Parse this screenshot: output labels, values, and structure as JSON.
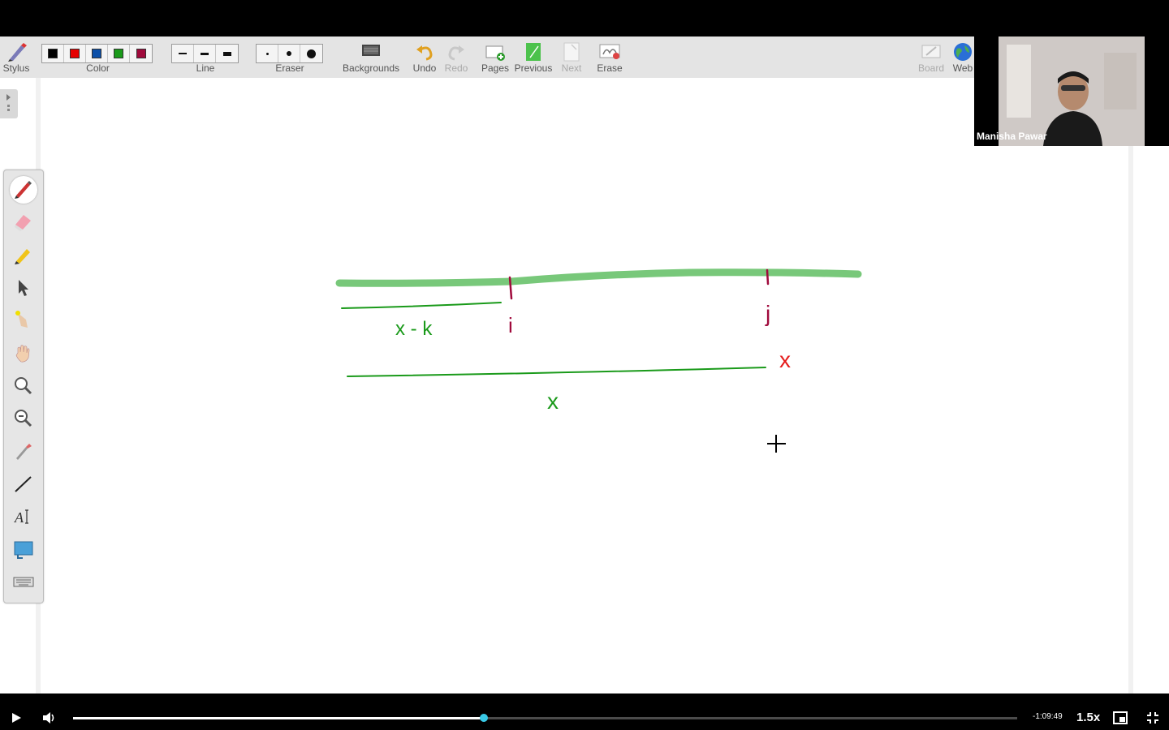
{
  "toolbar": {
    "stylus_label": "Stylus",
    "color_label": "Color",
    "colors": [
      "#000000",
      "#e50000",
      "#0b4fa8",
      "#1a9a1a",
      "#a00a3c"
    ],
    "line_label": "Line",
    "eraser_label": "Eraser",
    "backgrounds_label": "Backgrounds",
    "undo_label": "Undo",
    "redo_label": "Redo",
    "pages_label": "Pages",
    "previous_label": "Previous",
    "next_label": "Next",
    "erase_label": "Erase",
    "board_label": "Board",
    "web_label": "Web"
  },
  "side_tools": [
    "pen-icon",
    "eraser-icon",
    "highlighter-icon",
    "pointer-arrow-icon",
    "laser-pointer-icon",
    "hand-pan-icon",
    "zoom-in-icon",
    "zoom-out-icon",
    "eyedropper-icon",
    "line-tool-icon",
    "text-tool-icon",
    "image-tool-icon",
    "keyboard-icon"
  ],
  "board": {
    "label_x_minus_k": "x - k",
    "label_i": "i",
    "label_j": "j",
    "label_x_green": "x",
    "label_x_red": "x",
    "colors": {
      "green_band": "#78c87a",
      "green_ink": "#1a9a1a",
      "maroon_ink": "#a00a3c",
      "red_ink": "#e51c1c"
    }
  },
  "presenter": {
    "name": "Manisha Pawar"
  },
  "player": {
    "remaining_time": "-1:09:49",
    "speed": "1.5x",
    "progress_fraction": 0.435,
    "accent": "#39c9e6"
  }
}
